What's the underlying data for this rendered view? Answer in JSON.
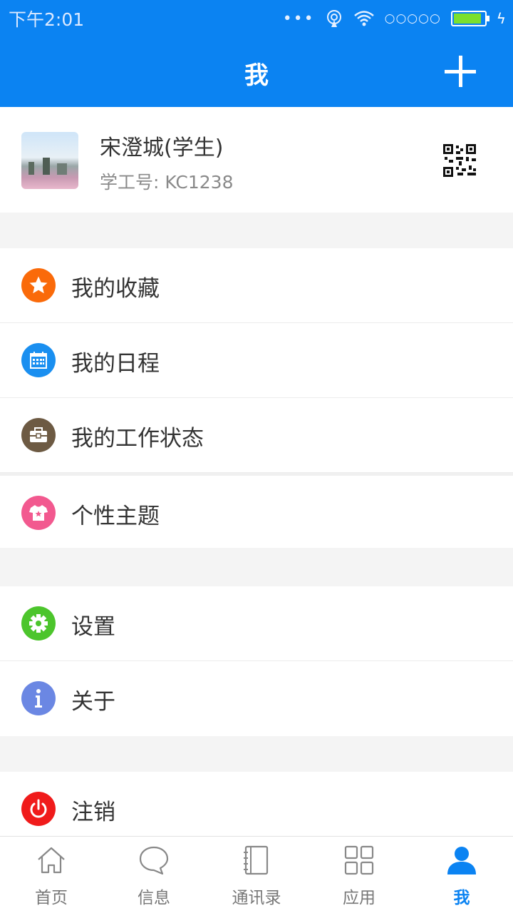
{
  "status_bar": {
    "time": "下午2:01",
    "signal_text": "○○○○○"
  },
  "header": {
    "title": "我",
    "add_icon": "plus-icon"
  },
  "profile": {
    "name": "宋澄城(学生)",
    "id_line": "学工号: KC1238",
    "qr_icon": "qrcode-icon"
  },
  "menu_groups": [
    {
      "items": [
        {
          "label": "我的收藏",
          "icon": "star-icon",
          "color": "#fa6a0a"
        },
        {
          "label": "我的日程",
          "icon": "calendar-icon",
          "color": "#1a8ff0"
        },
        {
          "label": "我的工作状态",
          "icon": "briefcase-icon",
          "color": "#6d5a43"
        },
        {
          "label": "个性主题",
          "icon": "tshirt-icon",
          "color": "#f2598f"
        }
      ]
    },
    {
      "items": [
        {
          "label": "设置",
          "icon": "gear-icon",
          "color": "#4cc52c"
        },
        {
          "label": "关于",
          "icon": "info-icon",
          "color": "#6b87e3"
        }
      ]
    },
    {
      "items": [
        {
          "label": "注销",
          "icon": "power-icon",
          "color": "#f01b1b"
        }
      ]
    }
  ],
  "tabs": [
    {
      "label": "首页",
      "icon": "home-icon"
    },
    {
      "label": "信息",
      "icon": "chat-bubble-icon"
    },
    {
      "label": "通讯录",
      "icon": "contacts-book-icon"
    },
    {
      "label": "应用",
      "icon": "apps-grid-icon"
    },
    {
      "label": "我",
      "icon": "person-icon",
      "active": true
    }
  ],
  "colors": {
    "brand": "#0b83f2",
    "inactive_tab": "#777777"
  }
}
